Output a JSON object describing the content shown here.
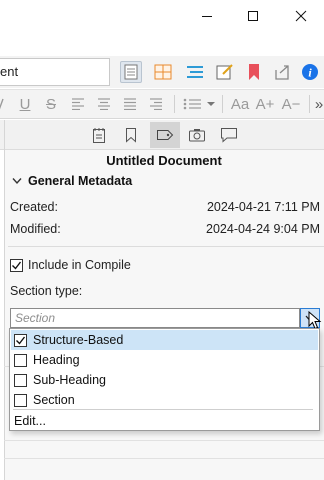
{
  "window": {
    "controls": [
      {
        "name": "minimize",
        "icon": "minimize-icon"
      },
      {
        "name": "maximize",
        "icon": "maximize-icon"
      },
      {
        "name": "close",
        "icon": "close-icon"
      }
    ]
  },
  "toolbar": {
    "search_value": "ent",
    "icons": [
      "view-document-icon",
      "view-corkboard-icon",
      "view-outliner-icon",
      "quick-reference-icon",
      "bookmark-icon",
      "share-icon",
      "info-icon"
    ],
    "accent": "#1a73e8"
  },
  "format_bar": {
    "items": [
      "italic",
      "underline",
      "strikethrough",
      "align-left",
      "align-center",
      "align-justify",
      "align-right",
      "list",
      "font-case",
      "font-size-up",
      "font-size-down",
      "more"
    ],
    "underline": "U",
    "strike": "S",
    "aa": "Aa",
    "a_up": "A+",
    "a_down": "A−",
    "more": "»"
  },
  "inspector": {
    "tabs": [
      "notes-icon",
      "bookmarks-icon",
      "metadata-icon",
      "snapshots-icon",
      "comments-icon"
    ],
    "active_tab": "metadata-icon",
    "document_title": "Untitled Document",
    "section_heading": "General Metadata",
    "created_label": "Created:",
    "created_value": "2024-04-21 7:11 PM",
    "modified_label": "Modified:",
    "modified_value": "2024-04-24 9:04 PM",
    "include_label": "Include in Compile",
    "include_checked": true,
    "section_type_label": "Section type:",
    "section_type_placeholder": "Section"
  },
  "dropdown": {
    "options": [
      {
        "label": "Structure-Based",
        "checked": true
      },
      {
        "label": "Heading",
        "checked": false
      },
      {
        "label": "Sub-Heading",
        "checked": false
      },
      {
        "label": "Section",
        "checked": false
      }
    ],
    "edit_label": "Edit..."
  }
}
